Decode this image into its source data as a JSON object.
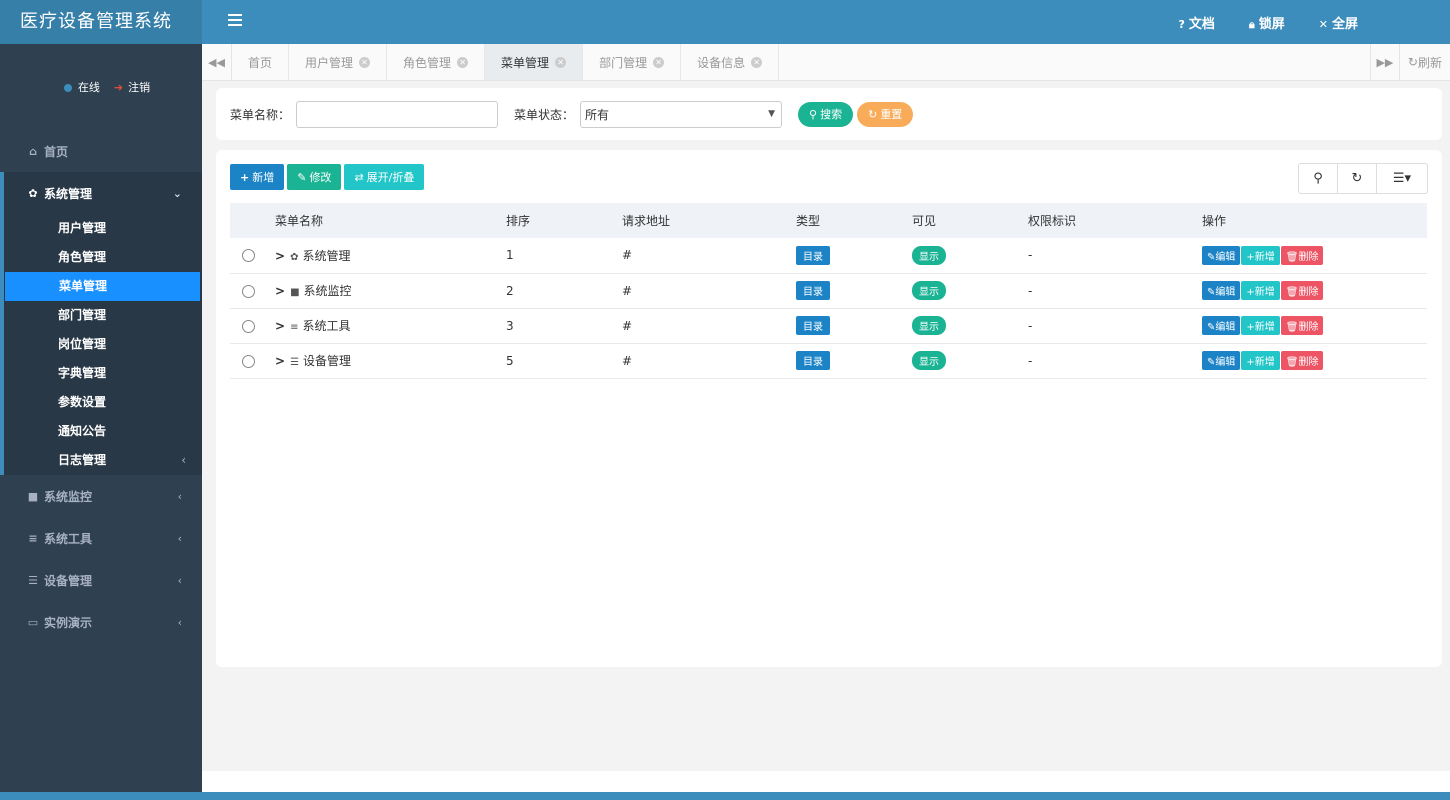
{
  "app": {
    "title": "医疗设备管理系统"
  },
  "user": {
    "online": "在线",
    "logout": "注销"
  },
  "sidebar": {
    "home": "首页",
    "system": {
      "label": "系统管理",
      "items": [
        {
          "label": "用户管理"
        },
        {
          "label": "角色管理"
        },
        {
          "label": "菜单管理"
        },
        {
          "label": "部门管理"
        },
        {
          "label": "岗位管理"
        },
        {
          "label": "字典管理"
        },
        {
          "label": "参数设置"
        },
        {
          "label": "通知公告"
        },
        {
          "label": "日志管理"
        }
      ]
    },
    "monitor": "系统监控",
    "tools": "系统工具",
    "devices": "设备管理",
    "demo": "实例演示"
  },
  "header": {
    "docs": "文档",
    "lock": "锁屏",
    "fullscreen": "全屏"
  },
  "tabs": {
    "items": [
      {
        "label": "首页"
      },
      {
        "label": "用户管理"
      },
      {
        "label": "角色管理"
      },
      {
        "label": "菜单管理"
      },
      {
        "label": "部门管理"
      },
      {
        "label": "设备信息"
      }
    ],
    "refresh": "刷新"
  },
  "search": {
    "name_label": "菜单名称：",
    "name_value": "",
    "status_label": "菜单状态：",
    "status_value": "所有",
    "search_btn": "搜索",
    "reset_btn": "重置"
  },
  "toolbar": {
    "add": "新增",
    "edit": "修改",
    "toggle": "展开/折叠"
  },
  "table": {
    "headers": {
      "name": "菜单名称",
      "order": "排序",
      "url": "请求地址",
      "type": "类型",
      "visible": "可见",
      "perm": "权限标识",
      "ops": "操作"
    },
    "actions": {
      "edit": "编辑",
      "add": "新增",
      "delete": "删除"
    },
    "rows": [
      {
        "name": "系统管理",
        "icon": "gear-icon",
        "order": "1",
        "url": "#",
        "type": "目录",
        "visible": "显示",
        "perm": "-"
      },
      {
        "name": "系统监控",
        "icon": "video-icon",
        "order": "2",
        "url": "#",
        "type": "目录",
        "visible": "显示",
        "perm": "-"
      },
      {
        "name": "系统工具",
        "icon": "bars-icon",
        "order": "3",
        "url": "#",
        "type": "目录",
        "visible": "显示",
        "perm": "-"
      },
      {
        "name": "设备管理",
        "icon": "database-icon",
        "order": "5",
        "url": "#",
        "type": "目录",
        "visible": "显示",
        "perm": "-"
      }
    ]
  },
  "colors": {
    "header": "#3c8dbc",
    "sidebar": "#2f4050",
    "selected": "#1890ff",
    "primary": "#1c84c6",
    "success": "#1ab394",
    "info": "#23c6c8",
    "warning": "#f8ac59",
    "danger": "#ed5565"
  }
}
